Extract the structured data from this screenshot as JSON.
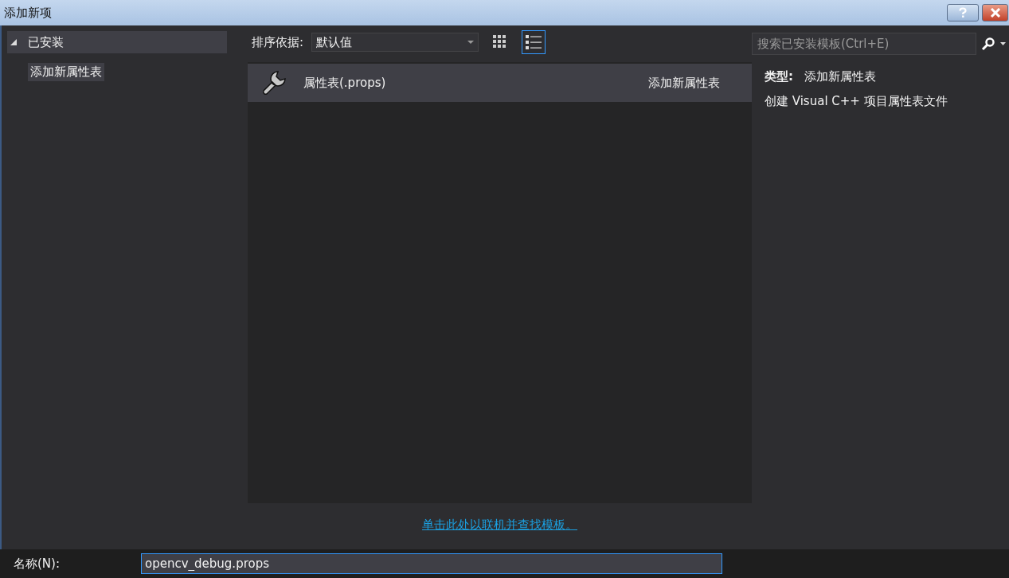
{
  "window": {
    "title": "添加新项"
  },
  "sidebar": {
    "items": [
      {
        "label": "已安装",
        "expanded": true,
        "selected": false,
        "children": [
          {
            "label": "添加新属性表",
            "selected": true
          }
        ]
      }
    ]
  },
  "toolbar": {
    "sort_label": "排序依据:",
    "sort_value": "默认值",
    "views": [
      {
        "kind": "grid",
        "selected": false
      },
      {
        "kind": "list",
        "selected": true
      }
    ]
  },
  "search": {
    "placeholder": "搜索已安装模板(Ctrl+E)"
  },
  "templates": [
    {
      "name": "属性表(.props)",
      "category": "添加新属性表",
      "selected": true
    }
  ],
  "details": {
    "type_label": "类型:",
    "type_value": "添加新属性表",
    "description": "创建 Visual C++ 项目属性表文件"
  },
  "online_link": "单击此处以联机并查找模板。",
  "name_field": {
    "label": "名称(N):",
    "value": "opencv_debug.props"
  }
}
